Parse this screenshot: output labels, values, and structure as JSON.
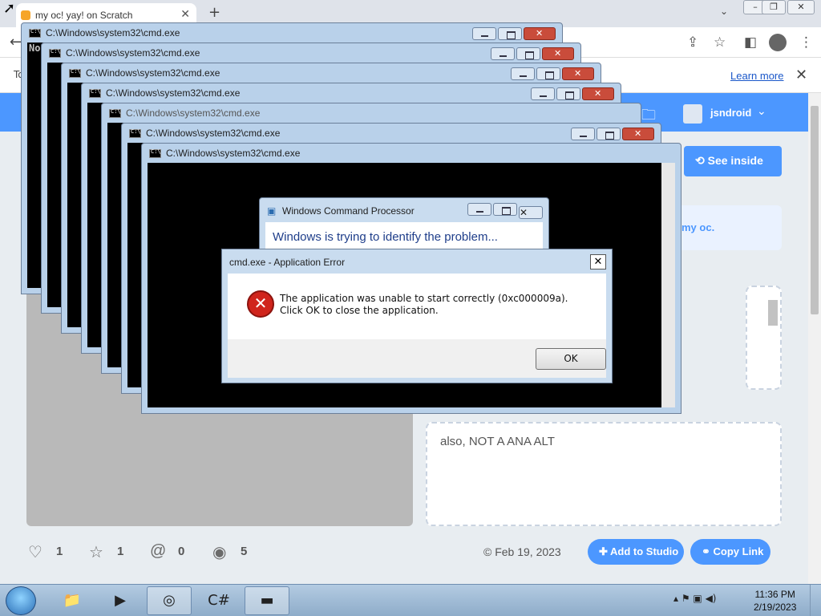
{
  "browser": {
    "tab_title": "my oc! yay! on Scratch",
    "tab_close": "✕",
    "new_tab": "+",
    "infobar_learn_more": "Learn more",
    "infobar_close": "✕",
    "infobar_partial": "To"
  },
  "scratch": {
    "username": "jsndroid",
    "see_inside": "See inside",
    "info_box_text": "my oc.",
    "notes_text": "also, NOT A ANA ALT",
    "stats": {
      "loves": "1",
      "favorites": "1",
      "remixes": "0",
      "views": "5"
    },
    "date": "© Feb 19, 2023",
    "add_to_studio": "Add to Studio",
    "copy_link": "Copy Link"
  },
  "cmd_windows": [
    {
      "title": "C:\\Windows\\system32\\cmd.exe",
      "console_text": "No"
    },
    {
      "title": "C:\\Windows\\system32\\cmd.exe"
    },
    {
      "title": "C:\\Windows\\system32\\cmd.exe"
    },
    {
      "title": "C:\\Windows\\system32\\cmd.exe"
    },
    {
      "title": "C:\\Windows\\system32\\cmd.exe"
    },
    {
      "title": "C:\\Windows\\system32\\cmd.exe"
    },
    {
      "title": "C:\\Windows\\system32\\cmd.exe"
    }
  ],
  "wcp_dialog": {
    "title": "Windows Command Processor",
    "message": "Windows is trying to identify the problem..."
  },
  "error_dialog": {
    "title": "cmd.exe - Application Error",
    "message": "The application was unable to start correctly (0xc000009a). Click OK to close the application.",
    "ok_label": "OK",
    "close_label": "✕"
  },
  "taskbar": {
    "time": "11:36 PM",
    "date": "2/19/2023"
  },
  "colors": {
    "scratch_blue": "#4c97ff",
    "error_red": "#d0241c",
    "window_frame": "#b9d1ea"
  }
}
